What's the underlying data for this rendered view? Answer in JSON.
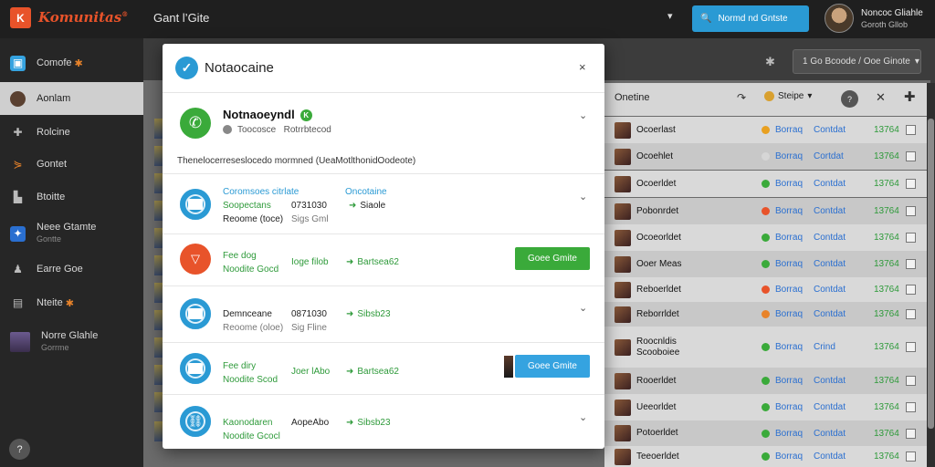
{
  "topbar": {
    "logo_glyph": "K",
    "brand": "Komunitas",
    "brand_mark": "®",
    "page_name": "Gant l’Gite",
    "action_label": "Normd nd Gntste",
    "user_name": "Noncoc Gliahle",
    "user_sub": "Goroth Gllob"
  },
  "sidebar": {
    "items": [
      {
        "label": "Comofe",
        "icon": "square-app-icon"
      },
      {
        "label": "Aonlam",
        "icon": "avatar-icon"
      },
      {
        "label": "Rolcine",
        "icon": "puzzle-icon"
      },
      {
        "label": "Gontet",
        "icon": "connector-icon"
      },
      {
        "label": "Btoitte",
        "icon": "building-icon"
      },
      {
        "label": "Neee Gtamte",
        "sub": "Gontte",
        "icon": "game-icon"
      },
      {
        "label": "Earre Goe",
        "icon": "person-icon"
      },
      {
        "label": "Nteite",
        "icon": "chat-icon"
      },
      {
        "label": "Norre Glahle",
        "sub": "Gorrme",
        "icon": "profile-thumb-icon"
      }
    ],
    "help": "?"
  },
  "toolbar": {
    "filter_label": "1 Go Bcoode / Ooe Ginote"
  },
  "table": {
    "header": {
      "name": "Onetine",
      "status": "Steipe",
      "help": "?"
    },
    "rows": [
      {
        "name": "Ocoerlast",
        "status": "Borraq",
        "type": "Contdat",
        "size": "13764",
        "dot": "#e8a020"
      },
      {
        "name": "Ocoehlet",
        "status": "Borraq",
        "type": "Cortdat",
        "size": "13764",
        "dot": "#d6d6d6"
      },
      {
        "name": "Ocoerldet",
        "status": "Borraq",
        "type": "Contdat",
        "size": "13764",
        "dot": "#3aaa3a"
      },
      {
        "name": "Pobonrdet",
        "status": "Borraq",
        "type": "Contdat",
        "size": "13764",
        "dot": "#e8532a"
      },
      {
        "name": "Ocoeorldet",
        "status": "Borraq",
        "type": "Contdat",
        "size": "13764",
        "dot": "#3aaa3a"
      },
      {
        "name": "Ooer Meas",
        "status": "Borraq",
        "type": "Contdat",
        "size": "13764",
        "dot": "#3aaa3a"
      },
      {
        "name": "Reboerldet",
        "status": "Borraq",
        "type": "Contdat",
        "size": "13764",
        "dot": "#e8532a"
      },
      {
        "name": "Reborrldet",
        "status": "Borraq",
        "type": "Contdat",
        "size": "13764",
        "dot": "#e8832a"
      },
      {
        "name": "Roocnldis",
        "name2": "Scooboiee",
        "status": "Borraq",
        "type": "Crind",
        "size": "13764",
        "dot": "#3aaa3a"
      },
      {
        "name": "Rooerldet",
        "status": "Borraq",
        "type": "Contdat",
        "size": "13764",
        "dot": "#3aaa3a"
      },
      {
        "name": "Ueeorldet",
        "status": "Borraq",
        "type": "Contdat",
        "size": "13764",
        "dot": "#3aaa3a"
      },
      {
        "name": "Potoerldet",
        "status": "Borraq",
        "type": "Contdat",
        "size": "13764",
        "dot": "#3aaa3a"
      },
      {
        "name": "Teeoerldet",
        "status": "Borraq",
        "type": "Contdat",
        "size": "13764",
        "dot": "#3aaa3a"
      }
    ]
  },
  "modal": {
    "title": "Notaocaine",
    "close": "×",
    "section": {
      "title": "Notnaoeyndl",
      "badge": "K",
      "sub_a": "Toocosce",
      "sub_b": "Rotrrbtecod",
      "description": "Thenelocerreseslocedo mormned (UeaMotlthonidOodeote)"
    },
    "items": [
      {
        "l1": "Coromsoes citrlate",
        "l2": "Soopectans",
        "l3": "Reoome (toce)",
        "c2a": "0731030",
        "c2b": "Sigs Gml",
        "c3a": "Oncotaine",
        "c3b": "Siaole",
        "icon": "blue"
      },
      {
        "l1": "Fee dog",
        "l2": "Noodite Gocd",
        "c2a": "Ioge filob",
        "c3a": "Bartsea62",
        "button": "Goee Gmite",
        "icon": "orange"
      },
      {
        "l1": "Demnceane",
        "l2": "Reoome (oloe)",
        "c2a": "0871030",
        "c2b": "Sig Fline",
        "c3a": "Sibsb23",
        "icon": "blue"
      },
      {
        "l1": "Fee diry",
        "l2": "Noodite Scod",
        "c2a": "Joer lAbo",
        "c3a": "Bartsea62",
        "button": "Goee Gmite",
        "icon": "blue"
      },
      {
        "l1": "Kaonodaren",
        "l2": "Noodite Gcocl",
        "c2a": "AopeAbo",
        "c3a": "Sibsb23",
        "icon": "blue"
      }
    ]
  },
  "colors": {
    "accent": "#2a9ad4",
    "brand": "#e8532a",
    "success": "#3aaa3a"
  }
}
